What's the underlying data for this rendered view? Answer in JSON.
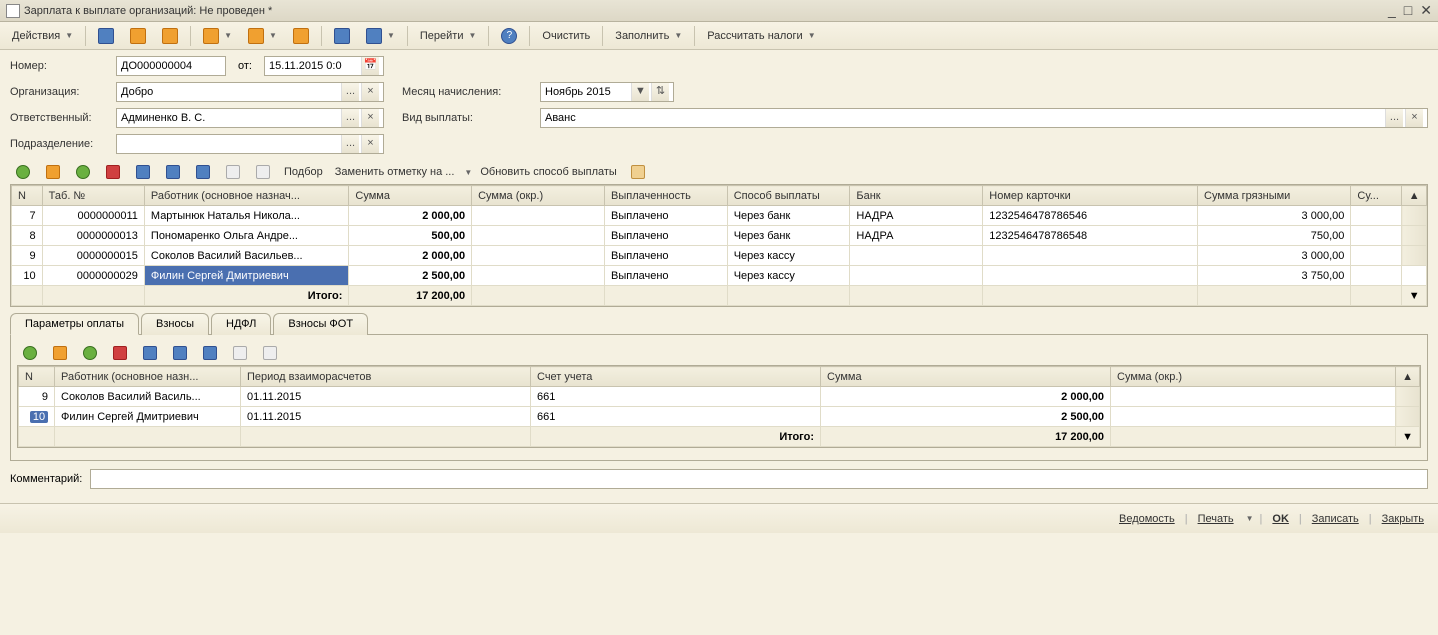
{
  "titlebar": {
    "title": "Зарплата к выплате организаций: Не проведен *"
  },
  "toolbar": {
    "actions": "Действия",
    "goto": "Перейти",
    "clear": "Очистить",
    "fill": "Заполнить",
    "calc_tax": "Рассчитать налоги"
  },
  "form": {
    "number_label": "Номер:",
    "number_value": "ДО000000004",
    "date_label": "от:",
    "date_value": "15.11.2015  0:0",
    "org_label": "Организация:",
    "org_value": "Добро",
    "month_label": "Месяц начисления:",
    "month_value": "Ноябрь 2015",
    "resp_label": "Ответственный:",
    "resp_value": "Админенко В. С.",
    "pay_type_label": "Вид выплаты:",
    "pay_type_value": "Аванс",
    "dept_label": "Подразделение:",
    "dept_value": ""
  },
  "subtoolbar": {
    "select": "Подбор",
    "replace": "Заменить отметку на ...",
    "update_method": "Обновить способ выплаты"
  },
  "main_table": {
    "headers": {
      "n": "N",
      "tab": "Таб. №",
      "worker": "Работник (основное назнач...",
      "sum": "Сумма",
      "sum_okr": "Сумма (окр.)",
      "paid": "Выплаченность",
      "method": "Способ выплаты",
      "bank": "Банк",
      "card": "Номер карточки",
      "sum_gross": "Сумма грязными",
      "su": "Су..."
    },
    "rows": [
      {
        "n": "7",
        "tab": "0000000011",
        "worker": "Мартынюк Наталья Никола...",
        "sum": "2 000,00",
        "sum_okr": "",
        "paid": "Выплачено",
        "method": "Через банк",
        "bank": "НАДРА",
        "card": "1232546478786546",
        "gross": "3 000,00"
      },
      {
        "n": "8",
        "tab": "0000000013",
        "worker": "Пономаренко Ольга Андре...",
        "sum": "500,00",
        "sum_okr": "",
        "paid": "Выплачено",
        "method": "Через банк",
        "bank": "НАДРА",
        "card": "1232546478786548",
        "gross": "750,00"
      },
      {
        "n": "9",
        "tab": "0000000015",
        "worker": "Соколов Василий Васильев...",
        "sum": "2 000,00",
        "sum_okr": "",
        "paid": "Выплачено",
        "method": "Через кассу",
        "bank": "",
        "card": "",
        "gross": "3 000,00"
      },
      {
        "n": "10",
        "tab": "0000000029",
        "worker": "Филин Сергей Дмитриевич",
        "sum": "2 500,00",
        "sum_okr": "",
        "paid": "Выплачено",
        "method": "Через кассу",
        "bank": "",
        "card": "",
        "gross": "3 750,00"
      }
    ],
    "total_label": "Итого:",
    "total_sum": "17 200,00"
  },
  "tabs": {
    "t1": "Параметры оплаты",
    "t2": "Взносы",
    "t3": "НДФЛ",
    "t4": "Взносы ФОТ"
  },
  "detail_table": {
    "headers": {
      "n": "N",
      "worker": "Работник (основное назн...",
      "period": "Период взаиморасчетов",
      "account": "Счет учета",
      "sum": "Сумма",
      "sum_okr": "Сумма (окр.)"
    },
    "rows": [
      {
        "n": "9",
        "worker": "Соколов Василий Василь...",
        "period": "01.11.2015",
        "account": "661",
        "sum": "2 000,00"
      },
      {
        "n": "10",
        "worker": "Филин Сергей Дмитриевич",
        "period": "01.11.2015",
        "account": "661",
        "sum": "2 500,00"
      }
    ],
    "total_label": "Итого:",
    "total_sum": "17 200,00"
  },
  "comment_label": "Комментарий:",
  "comment_value": "",
  "footer": {
    "sheet": "Ведомость",
    "print": "Печать",
    "ok": "OK",
    "save": "Записать",
    "close": "Закрыть"
  }
}
